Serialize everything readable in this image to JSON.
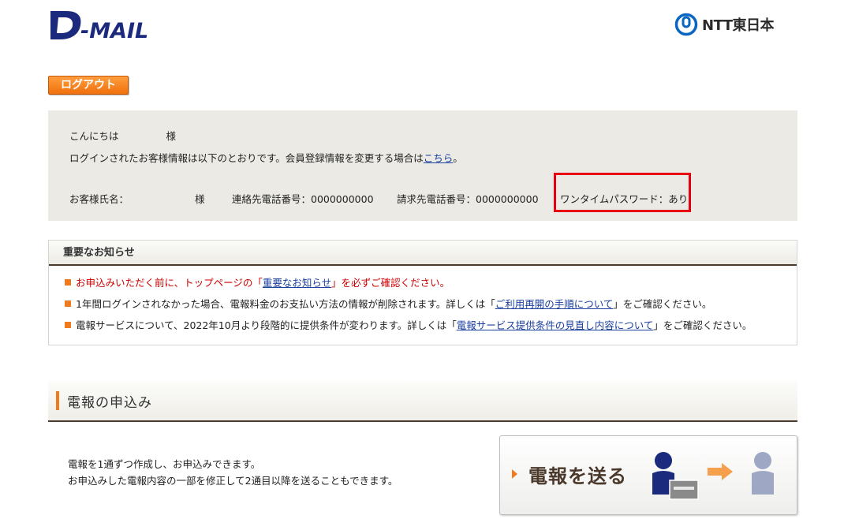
{
  "header": {
    "logo_text": "D-MAIL",
    "brand_text": "NTT東日本"
  },
  "logout_label": "ログアウト",
  "account": {
    "greeting": "こんにちは",
    "honorific": "様",
    "info_text": "ログインされたお客様情報は以下のとおりです。会員登録情報を変更する場合は",
    "info_link": "こちら",
    "info_end": "。",
    "name_label": "お客様氏名：",
    "name_honorific": "様",
    "contact_phone": "連絡先電話番号：0000000000",
    "billing_phone": "請求先電話番号：0000000000",
    "otp": "ワンタイムパスワード：あり"
  },
  "notices": {
    "title": "重要なお知らせ",
    "n1_pre": "お申込みいただく前に、トップページの「",
    "n1_link": "重要なお知らせ",
    "n1_post": "」を必ずご確認ください。",
    "n2_pre": "1年間ログインされなかった場合、電報料金のお支払い方法の情報が削除されます。詳しくは「",
    "n2_link": "ご利用再開の手順について",
    "n2_post": "」をご確認ください。",
    "n3_pre": "電報サービスについて、2022年10月より段階的に提供条件が変わります。詳しくは「",
    "n3_link": "電報サービス提供条件の見直し内容について",
    "n3_post": "」をご確認ください。"
  },
  "section": {
    "title": "電報の申込み",
    "desc_line1": "電報を1通ずつ作成し、お申込みできます。",
    "desc_line2": "お申込みした電報内容の一部を修正して2通目以降を送ることもできます。",
    "send_button": "電報を送る"
  }
}
